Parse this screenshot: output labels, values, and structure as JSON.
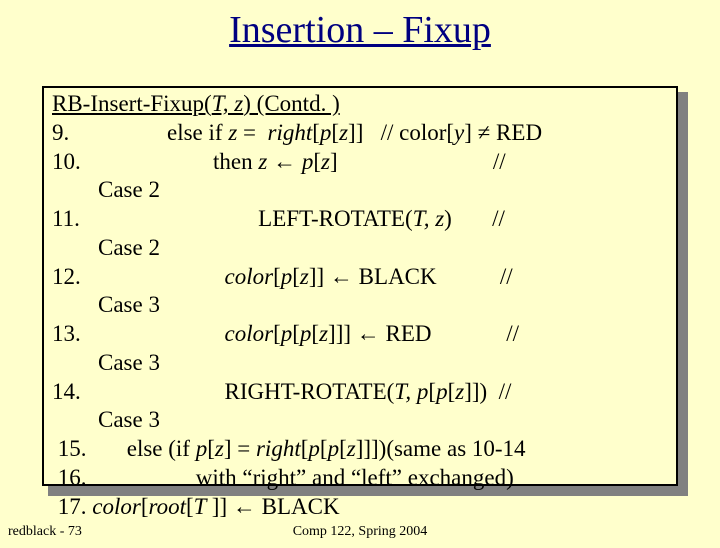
{
  "title": "Insertion – Fixup",
  "header_plain": "RB-Insert-Fixup(",
  "header_args": "T, z",
  "header_tail": ") (Contd. )",
  "l9a": "9.                 else if ",
  "l9b": "z",
  "l9c": " =  ",
  "l9d": "right",
  "l9e": "[",
  "l9f": "p",
  "l9g": "[",
  "l9h": "z",
  "l9i": "]]   // color[",
  "l9j": "y",
  "l9k": "] ≠ RED",
  "l10a": "10.                       then ",
  "l10b": "z",
  "l10c": " ← ",
  "l10d": "p",
  "l10e": "[",
  "l10f": "z",
  "l10g": "]                           //",
  "c2a": "        Case 2",
  "l11a": "11.                               LEFT-ROTATE(",
  "l11b": "T, z",
  "l11c": ")       //",
  "c2b": "        Case 2",
  "l12a": "12.                         ",
  "l12b": "color",
  "l12c": "[",
  "l12d": "p",
  "l12e": "[",
  "l12f": "z",
  "l12g": "]] ← BLACK           //",
  "c3a": "        Case 3",
  "l13a": "13.                         ",
  "l13b": "color",
  "l13c": "[",
  "l13d": "p",
  "l13e": "[",
  "l13f": "p",
  "l13g": "[",
  "l13h": "z",
  "l13i": "]]] ← RED             //",
  "c3b": "        Case 3",
  "l14a": "14.                         RIGHT-ROTATE(",
  "l14b": "T, p",
  "l14c": "[",
  "l14d": "p",
  "l14e": "[",
  "l14f": "z",
  "l14g": "]])  //",
  "c3c": "        Case 3",
  "l15a": " 15.       else (if ",
  "l15b": "p",
  "l15c": "[",
  "l15d": "z",
  "l15e": "] = ",
  "l15f": "right",
  "l15g": "[",
  "l15h": "p",
  "l15i": "[",
  "l15j": "p",
  "l15k": "[",
  "l15l": "z",
  "l15m": "]]])(same as 10-14",
  "l16": " 16.                   with “right” and “left” exchanged)",
  "l17a": " 17. ",
  "l17b": "color",
  "l17c": "[",
  "l17d": "root",
  "l17e": "[",
  "l17f": "T ",
  "l17g": "]] ← BLACK",
  "footer_left": "redblack - 73",
  "footer_center": "Comp 122, Spring 2004"
}
